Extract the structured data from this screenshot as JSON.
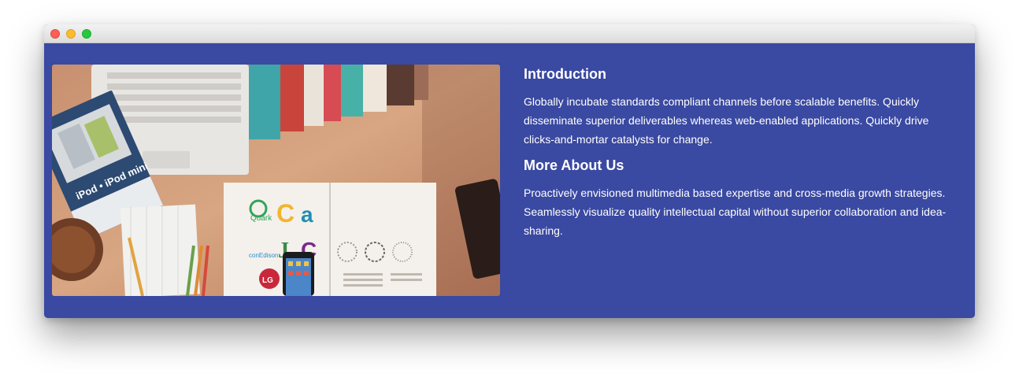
{
  "window": {
    "buttons": [
      "close",
      "minimize",
      "zoom"
    ]
  },
  "image": {
    "icon": "desk-workspace-photo",
    "booklet_text": "iPod • iPod mini",
    "logo_labels": [
      "Quark",
      "conEdison",
      "LG"
    ]
  },
  "sections": [
    {
      "heading": "Introduction",
      "body": "Globally incubate standards compliant channels before scalable benefits. Quickly disseminate superior deliverables whereas web-enabled applications. Quickly drive clicks-and-mortar catalysts for change."
    },
    {
      "heading": "More About Us",
      "body": "Proactively envisioned multimedia based expertise and cross-media growth strategies. Seamlessly visualize quality intellectual capital without superior collaboration and idea-sharing."
    }
  ],
  "colors": {
    "background": "#3a49a1",
    "text": "#ffffff"
  }
}
